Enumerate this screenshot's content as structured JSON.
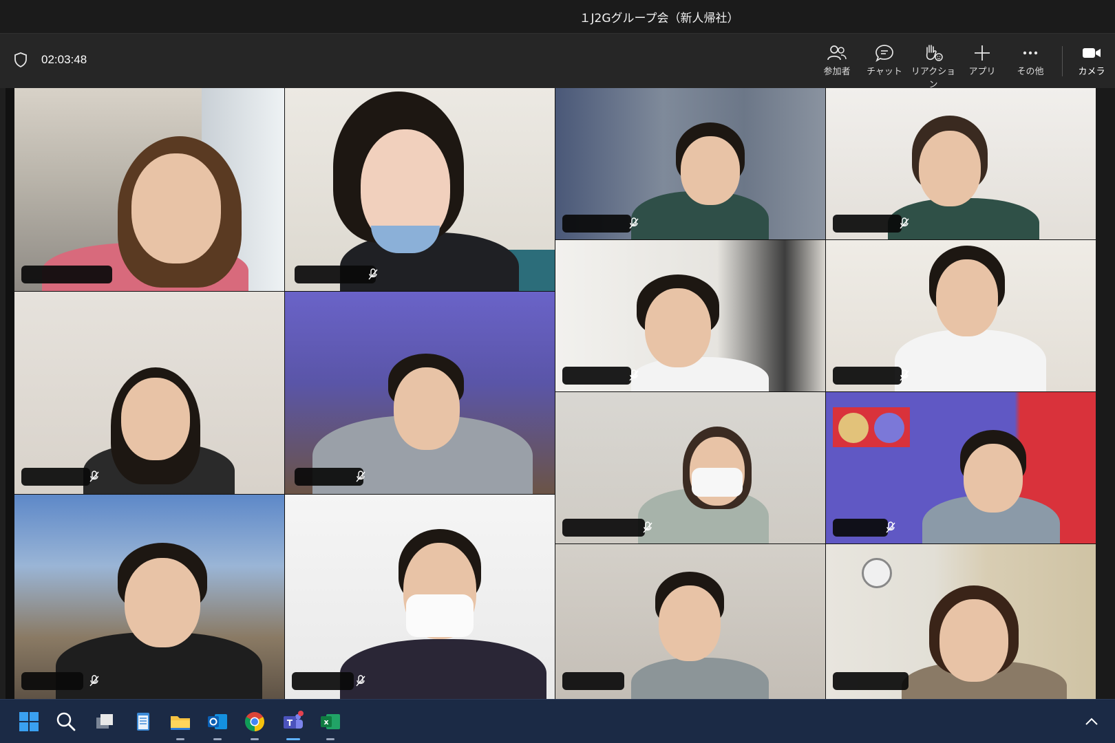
{
  "window": {
    "title": "１J2Gグループ会（新人帰社）"
  },
  "toolbar": {
    "timer": "02:03:48",
    "buttons": [
      {
        "id": "participants",
        "label": "参加者",
        "icon": "people-icon"
      },
      {
        "id": "chat",
        "label": "チャット",
        "icon": "chat-icon"
      },
      {
        "id": "reactions",
        "label": "リアクション",
        "icon": "raise-hand-icon"
      },
      {
        "id": "apps",
        "label": "アプリ",
        "icon": "plus-icon"
      },
      {
        "id": "more",
        "label": "その他",
        "icon": "more-icon"
      },
      {
        "id": "camera",
        "label": "カメラ",
        "icon": "camera-icon"
      }
    ]
  },
  "participants": [
    {
      "id": "p1",
      "name_redacted": true
    },
    {
      "id": "p2",
      "name_redacted": true
    },
    {
      "id": "p3",
      "name_redacted": true
    },
    {
      "id": "p4",
      "name_redacted": true
    },
    {
      "id": "p5",
      "name_redacted": true
    },
    {
      "id": "p6",
      "name_redacted": true
    },
    {
      "id": "p7",
      "name_redacted": true
    },
    {
      "id": "p8",
      "name_redacted": true
    },
    {
      "id": "p9",
      "name_redacted": true
    },
    {
      "id": "p10",
      "name_redacted": true
    },
    {
      "id": "p11",
      "name_redacted": true
    },
    {
      "id": "p12",
      "name_redacted": true
    },
    {
      "id": "p13",
      "name_redacted": true
    },
    {
      "id": "p14",
      "name_redacted": true
    }
  ],
  "taskbar": {
    "icons": [
      "windows-start-icon",
      "search-icon",
      "task-view-icon",
      "notepad-icon",
      "file-explorer-icon",
      "outlook-icon",
      "chrome-icon",
      "teams-icon",
      "excel-icon",
      "chevron-up-icon"
    ]
  },
  "colors": {
    "titlebar": "#1b1b1b",
    "toolbar": "#262626",
    "taskbar": "#1b2a45",
    "accent": "#5fb2ff"
  }
}
